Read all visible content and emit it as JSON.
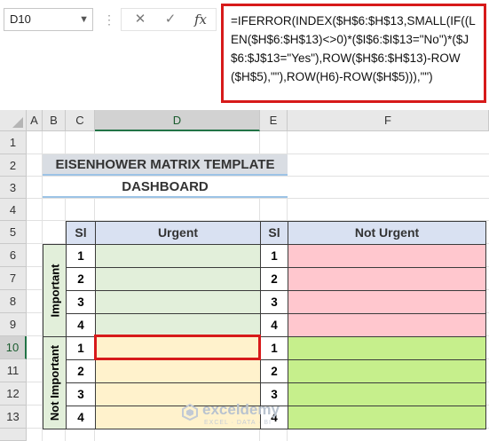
{
  "formula_bar": {
    "name_box": "D10",
    "cancel_icon": "✕",
    "enter_icon": "✓",
    "fx_label": "fx",
    "formula": "=IFERROR(INDEX($H$6:$H$13,SMALL(IF((LEN($H$6:$H$13)<>0)*($I$6:$I$13=\"No\")*($J$6:$J$13=\"Yes\"),ROW($H$6:$H$13)-ROW($H$5),\"\"),ROW(H6)-ROW($H$5))),\"\")"
  },
  "columns": [
    "A",
    "B",
    "C",
    "D",
    "E",
    "F"
  ],
  "rows": [
    "1",
    "2",
    "3",
    "4",
    "5",
    "6",
    "7",
    "8",
    "9",
    "10",
    "11",
    "12",
    "13"
  ],
  "selected_cell": "D10",
  "sheet": {
    "title": "EISENHOWER MATRIX TEMPLATE",
    "subtitle": "DASHBOARD",
    "sl_header_left": "Sl",
    "urgent_header": "Urgent",
    "sl_header_right": "Sl",
    "not_urgent_header": "Not Urgent",
    "important_label": "Important",
    "not_important_label": "Not Important",
    "numbers_top_left": [
      "1",
      "2",
      "3",
      "4"
    ],
    "numbers_bottom_left": [
      "1",
      "2",
      "3",
      "4"
    ],
    "numbers_top_right": [
      "1",
      "2",
      "3",
      "4"
    ],
    "numbers_bottom_right": [
      "1",
      "2",
      "3",
      "4"
    ]
  },
  "watermark": {
    "brand": "exceldemy",
    "tagline": "EXCEL · DATA · BI"
  },
  "colors": {
    "urgent_important": "#e2efda",
    "not_urgent_important": "#ffc7ce",
    "urgent_not_important": "#fff2cc",
    "not_urgent_not_important": "#c6ef8c",
    "header_fill": "#d9e1f2",
    "label_fill": "#e2efda",
    "selection_border": "#d71a1a"
  }
}
